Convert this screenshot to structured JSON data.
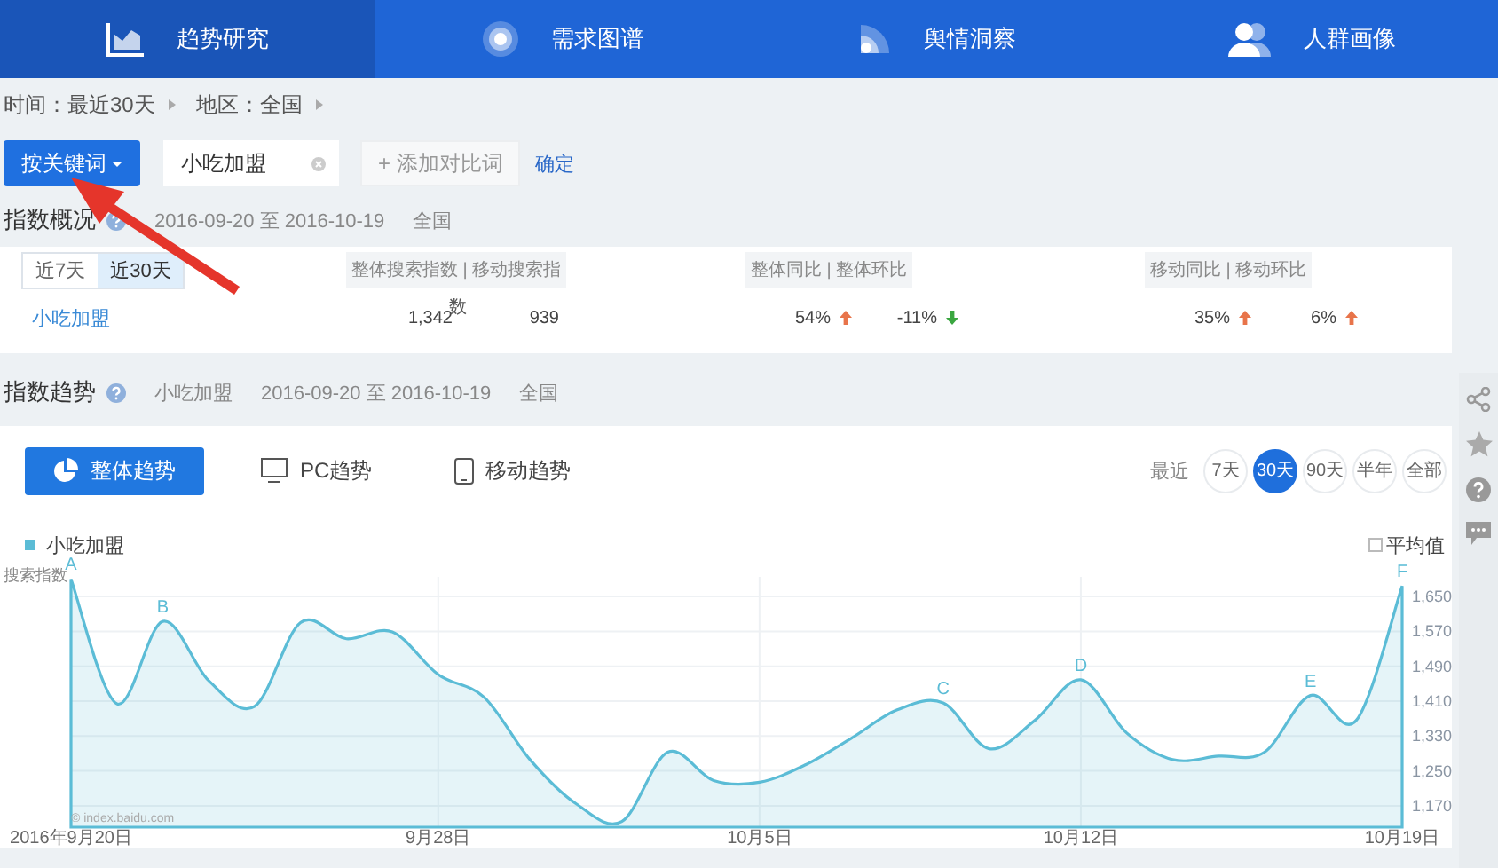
{
  "nav": [
    {
      "label": "趋势研究",
      "kind": "trend",
      "selected": true
    },
    {
      "label": "需求图谱",
      "kind": "demand",
      "selected": false
    },
    {
      "label": "舆情洞察",
      "kind": "opinion",
      "selected": false
    },
    {
      "label": "人群画像",
      "kind": "people",
      "selected": false
    }
  ],
  "filters": [
    "时间：最近30天",
    "地区：全国"
  ],
  "search": {
    "button": "按关键词",
    "keyword": "小吃加盟",
    "add": "+ 添加对比词",
    "confirm": "确定"
  },
  "overview": {
    "title": "指数概况",
    "range": "2016-09-20 至 2016-10-19",
    "region": "全国",
    "periods": [
      {
        "label": "近7天",
        "selected": false
      },
      {
        "label": "近30天",
        "selected": true
      }
    ],
    "keyword": "小吃加盟",
    "groups": [
      {
        "header": "整体搜索指数 | 移动搜索指",
        "overflow": "数",
        "cells": [
          {
            "value": "1,342"
          },
          {
            "value": "939"
          }
        ]
      },
      {
        "header": "整体同比 | 整体环比",
        "cells": [
          {
            "value": "54%",
            "rising": true
          },
          {
            "value": "-11%",
            "rising": false
          }
        ]
      },
      {
        "header": "移动同比 | 移动环比",
        "cells": [
          {
            "value": "35%",
            "rising": true
          },
          {
            "value": "6%",
            "rising": true
          }
        ]
      }
    ]
  },
  "trend": {
    "title": "指数趋势",
    "keyword": "小吃加盟",
    "range": "2016-09-20 至 2016-10-19",
    "region": "全国",
    "views": [
      {
        "label": "整体趋势",
        "kind": "total",
        "selected": true
      },
      {
        "label": "PC趋势",
        "kind": "pc",
        "selected": false
      },
      {
        "label": "移动趋势",
        "kind": "mobile",
        "selected": false
      }
    ],
    "range_label": "最近",
    "ranges": [
      {
        "label": "7天",
        "selected": false
      },
      {
        "label": "30天",
        "selected": true
      },
      {
        "label": "90天",
        "selected": false
      },
      {
        "label": "半年",
        "selected": false
      },
      {
        "label": "全部",
        "selected": false
      }
    ],
    "average": {
      "label": "平均值",
      "checked": false
    },
    "credit": "© index.baidu.com",
    "chart_data": {
      "type": "area",
      "ylabel": "搜索指数",
      "categories": [
        "2016年9月20日",
        null,
        null,
        null,
        null,
        null,
        null,
        null,
        "9月28日",
        null,
        null,
        null,
        null,
        null,
        null,
        "10月5日",
        null,
        null,
        null,
        null,
        null,
        null,
        "10月12日",
        null,
        null,
        null,
        null,
        null,
        null,
        "10月19日"
      ],
      "series": [
        {
          "name": "小吃加盟",
          "color": "#5bbcd6",
          "values": [
            1690,
            1404,
            1593,
            1457,
            1398,
            1590,
            1553,
            1569,
            1471,
            1419,
            1276,
            1175,
            1134,
            1293,
            1228,
            1224,
            1264,
            1325,
            1390,
            1406,
            1301,
            1366,
            1459,
            1337,
            1276,
            1284,
            1293,
            1423,
            1366,
            1674
          ]
        }
      ],
      "ylim": [
        1121,
        1695
      ],
      "grid": true,
      "yticks": [
        {
          "value": 1170,
          "label": "1,170"
        },
        {
          "value": 1250,
          "label": "1,250"
        },
        {
          "value": 1330,
          "label": "1,330"
        },
        {
          "value": 1410,
          "label": "1,410"
        },
        {
          "value": 1490,
          "label": "1,490"
        },
        {
          "value": 1570,
          "label": "1,570"
        },
        {
          "value": 1650,
          "label": "1,650"
        }
      ],
      "annotations": [
        {
          "y": 1690,
          "text": "A"
        },
        {
          "y": 1593,
          "text": "B"
        },
        {
          "y": 1406,
          "text": "C"
        },
        {
          "y": 1459,
          "text": "D"
        },
        {
          "y": 1423,
          "text": "E"
        },
        {
          "y": 1674,
          "text": "F"
        }
      ]
    }
  }
}
